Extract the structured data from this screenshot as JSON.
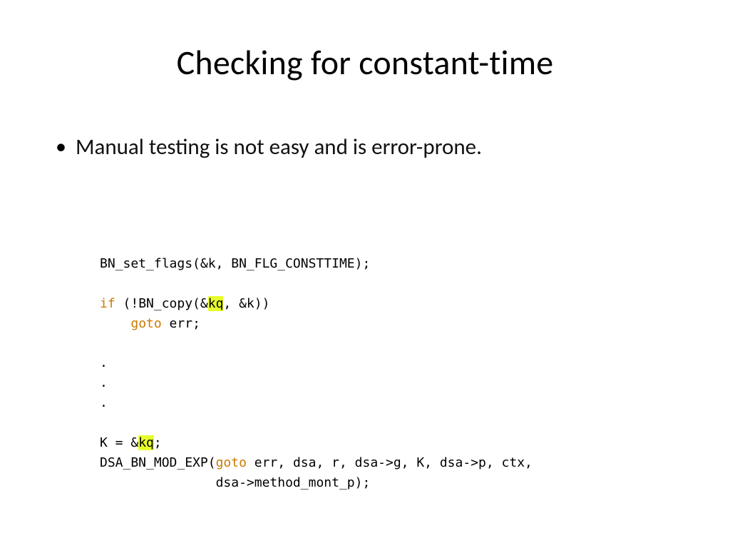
{
  "title": "Checking for constant-time",
  "bullets": [
    "Manual testing is not easy and is error-prone."
  ],
  "code": {
    "line1_a": "BN_set_flags(&k, BN_FLG_CONSTTIME);",
    "blank1": "",
    "line2_kw": "if",
    "line2_b": " (!BN_copy(&",
    "line2_hl": "kq",
    "line2_c": ", &k))",
    "line3_pad": "    ",
    "line3_kw": "goto",
    "line3_b": " err;",
    "blank2": "",
    "dot": ".",
    "blank3": "",
    "line7_a": "K = &",
    "line7_hl": "kq",
    "line7_b": ";",
    "line8_a": "DSA_BN_MOD_EXP(",
    "line8_kw": "goto",
    "line8_b": " err, dsa, r, dsa->g, K, dsa->p, ctx,",
    "line9_pad": "               ",
    "line9_a": "dsa->method_mont_p);"
  }
}
